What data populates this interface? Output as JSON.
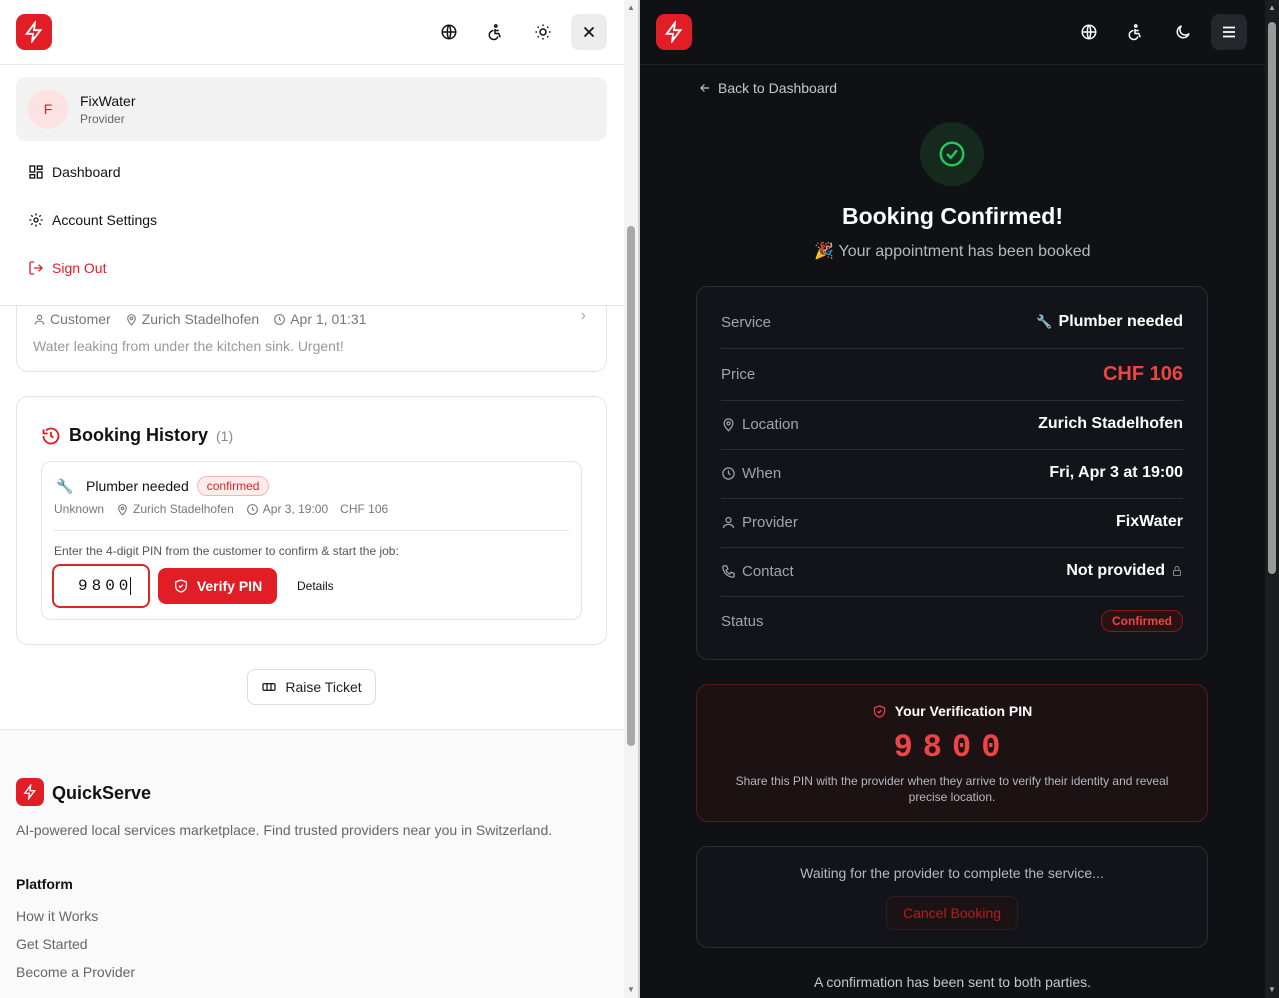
{
  "brand": {
    "name": "QuickServe",
    "tagline": "AI-powered local services marketplace. Find trusted providers near you in Switzerland.",
    "accent": "#e11d25"
  },
  "left": {
    "user": {
      "initial": "F",
      "name": "FixWater",
      "role": "Provider"
    },
    "menu": [
      {
        "label": "Dashboard",
        "icon": "grid-icon"
      },
      {
        "label": "Account Settings",
        "icon": "gear-icon"
      },
      {
        "label": "Sign Out",
        "icon": "logout-icon"
      }
    ],
    "request_card": {
      "customer": "Customer",
      "location": "Zurich Stadelhofen",
      "time": "Apr 1, 01:31",
      "description": "Water leaking from under the kitchen sink. Urgent!"
    },
    "history": {
      "title": "Booking History",
      "count": "(1)",
      "item": {
        "service": "Plumber needed",
        "status": "confirmed",
        "customer": "Unknown",
        "location": "Zurich Stadelhofen",
        "time": "Apr 3, 19:00",
        "price": "CHF 106",
        "pin_prompt": "Enter the 4-digit PIN from the customer to confirm & start the job:",
        "pin_value": "9800",
        "verify_label": "Verify PIN",
        "details_label": "Details"
      }
    },
    "raise_ticket": "Raise Ticket",
    "footer": {
      "platform_heading": "Platform",
      "links": [
        "How it Works",
        "Get Started",
        "Become a Provider"
      ]
    }
  },
  "right": {
    "back_label": "Back to Dashboard",
    "title": "Booking Confirmed!",
    "subtitle": "Your appointment has been booked",
    "rows": {
      "service": {
        "label": "Service",
        "value": "Plumber needed"
      },
      "price": {
        "label": "Price",
        "value": "CHF 106"
      },
      "location": {
        "label": "Location",
        "value": "Zurich Stadelhofen"
      },
      "when": {
        "label": "When",
        "value": "Fri, Apr 3 at 19:00"
      },
      "provider": {
        "label": "Provider",
        "value": "FixWater"
      },
      "contact": {
        "label": "Contact",
        "value": "Not provided"
      },
      "status": {
        "label": "Status",
        "value": "Confirmed"
      }
    },
    "pin": {
      "title": "Your Verification PIN",
      "value": "9800",
      "note": "Share this PIN with the provider when they arrive to verify their identity and reveal precise location."
    },
    "waiting": {
      "text": "Waiting for the provider to complete the service...",
      "cancel_label": "Cancel Booking"
    },
    "confirmation_note": "A confirmation has been sent to both parties."
  }
}
